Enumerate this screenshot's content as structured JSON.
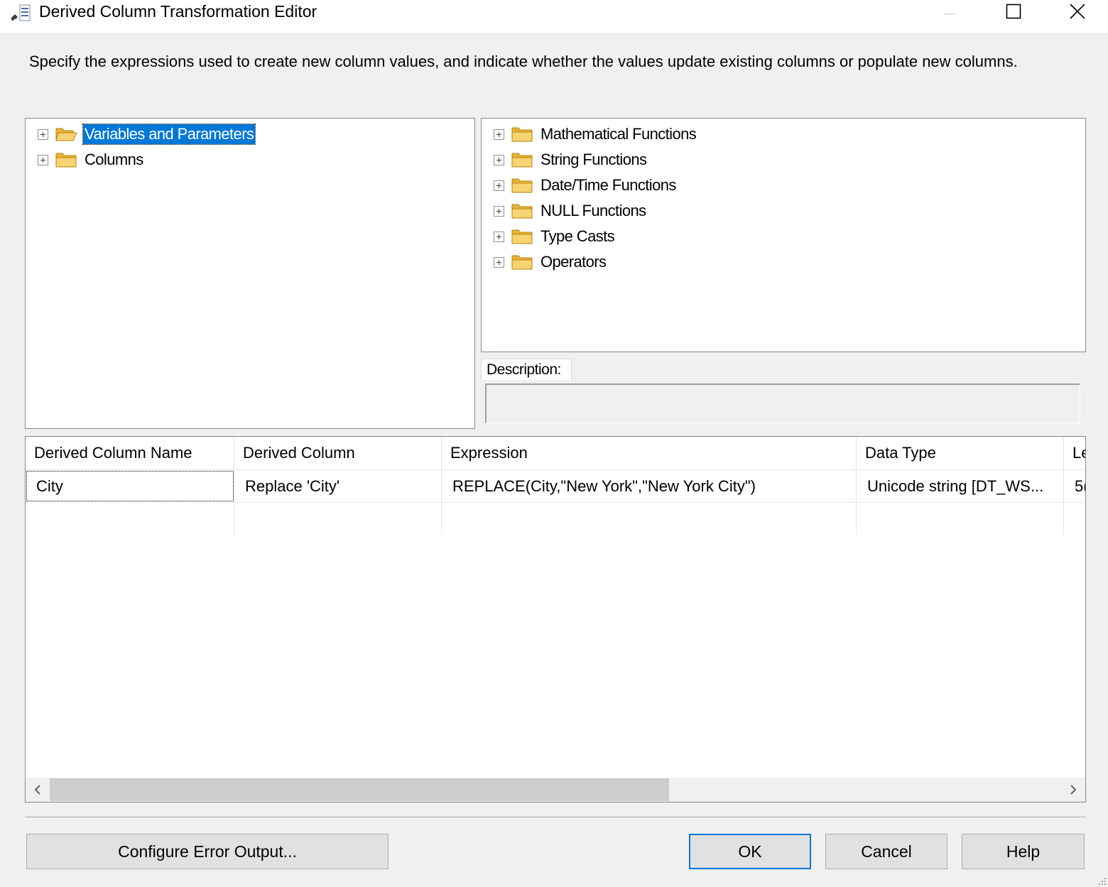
{
  "window": {
    "title": "Derived Column Transformation Editor"
  },
  "instructions": "Specify the expressions used to create new column values, and indicate whether the values update existing columns or populate new columns.",
  "left_tree": {
    "items": [
      {
        "label": "Variables and Parameters",
        "icon": "folder-open-icon",
        "selected": true
      },
      {
        "label": "Columns",
        "icon": "folder-icon",
        "selected": false
      }
    ]
  },
  "right_tree": {
    "items": [
      {
        "label": "Mathematical Functions",
        "icon": "folder-icon"
      },
      {
        "label": "String Functions",
        "icon": "folder-icon"
      },
      {
        "label": "Date/Time Functions",
        "icon": "folder-icon"
      },
      {
        "label": "NULL Functions",
        "icon": "folder-icon"
      },
      {
        "label": "Type Casts",
        "icon": "folder-icon"
      },
      {
        "label": "Operators",
        "icon": "folder-icon"
      }
    ]
  },
  "description": {
    "label": "Description:",
    "value": ""
  },
  "grid": {
    "columns": [
      "Derived Column Name",
      "Derived Column",
      "Expression",
      "Data Type",
      "Le"
    ],
    "rows": [
      [
        "City",
        "Replace 'City'",
        "REPLACE(City,\"New York\",\"New York City\")",
        "Unicode string [DT_WS...",
        "5("
      ],
      [
        "",
        "",
        "",
        "",
        ""
      ]
    ]
  },
  "buttons": {
    "configure_error_output": "Configure Error Output...",
    "ok": "OK",
    "cancel": "Cancel",
    "help": "Help"
  },
  "colors": {
    "selection": "#0078d7",
    "folder": "#f3c95a",
    "default_button_border": "#0078d7"
  }
}
